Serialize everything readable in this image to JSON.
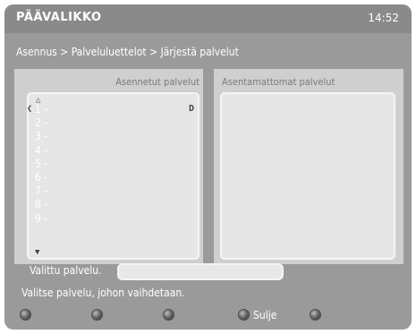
{
  "header": {
    "title": "PÄÄVALIKKO",
    "time": "14:52"
  },
  "breadcrumb": "Asennus > Palveluluettelot > Järjestä palvelut",
  "installed": {
    "header": "Asennetut palvelut",
    "slots": [
      "1 -",
      "2 -",
      "3 -",
      "4 -",
      "5 -",
      "6 -",
      "7 -",
      "8 -",
      "9 -"
    ]
  },
  "uninstalled": {
    "header": "Asentamattomat palvelut",
    "slots": []
  },
  "selected": {
    "label": "Valittu palvelu.",
    "value": ""
  },
  "status": "Valitse palvelu, johon vaihdetaan.",
  "footer": {
    "close_label": "Sulje"
  },
  "icons": {
    "scroll_up": "arrow-up-icon",
    "scroll_down": "arrow-down-icon",
    "row_left": "left-marker-icon",
    "row_right": "right-marker-icon",
    "remote_key": "remote-button-icon"
  }
}
